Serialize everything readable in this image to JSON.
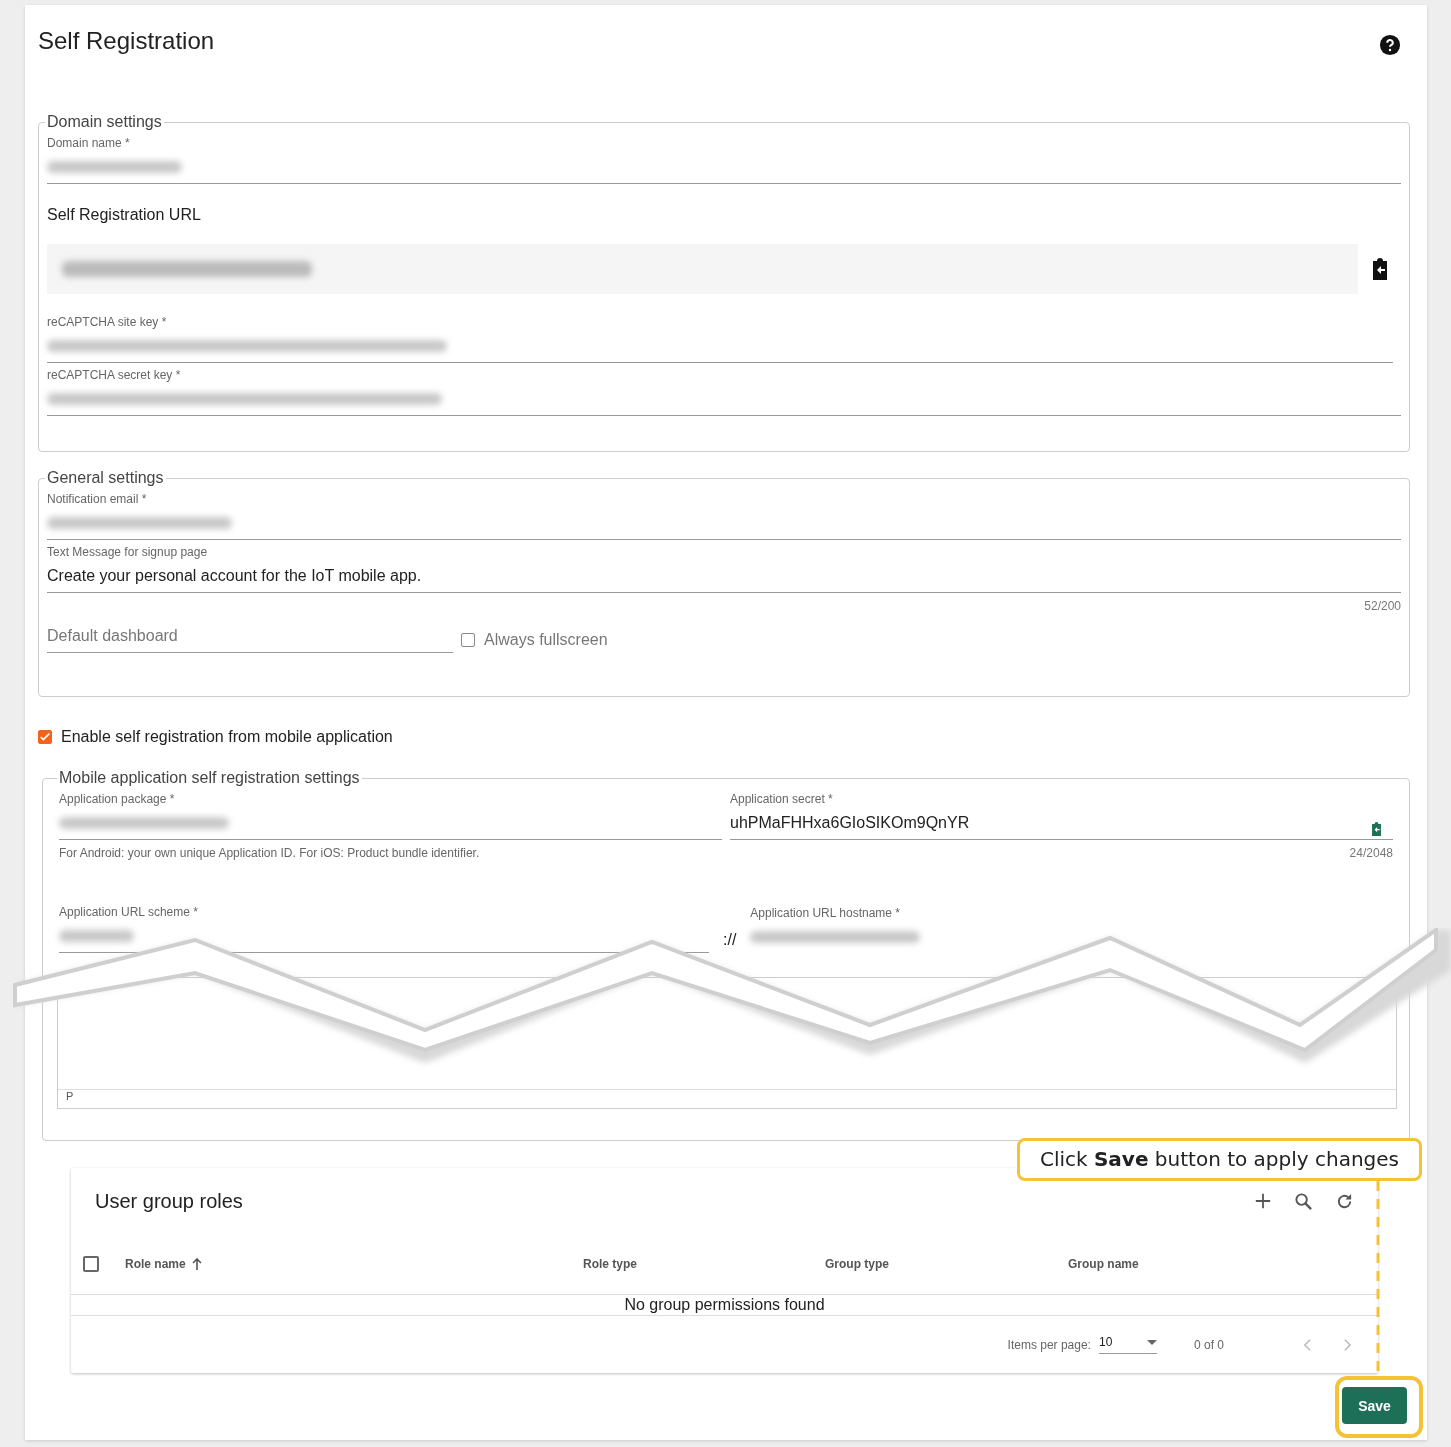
{
  "page": {
    "title": "Self Registration"
  },
  "domain_settings": {
    "legend": "Domain settings",
    "domain_name": {
      "label": "Domain name *"
    },
    "url_label": "Self Registration URL",
    "recaptcha_site_key": {
      "label": "reCAPTCHA site key *"
    },
    "recaptcha_secret_key": {
      "label": "reCAPTCHA secret key *"
    }
  },
  "general_settings": {
    "legend": "General settings",
    "notification_email": {
      "label": "Notification email *"
    },
    "signup_message": {
      "label": "Text Message for signup page",
      "value": "Create your personal account for the IoT mobile app.",
      "counter": "52/200"
    },
    "default_dashboard": {
      "placeholder": "Default dashboard"
    },
    "always_fullscreen": {
      "label": "Always fullscreen",
      "checked": false
    }
  },
  "enable_mobile": {
    "label": "Enable self registration from mobile application",
    "checked": true
  },
  "mobile_settings": {
    "legend": "Mobile application self registration settings",
    "application_package": {
      "label": "Application package *",
      "hint": "For Android: your own unique Application ID. For iOS: Product bundle identifier."
    },
    "application_secret": {
      "label": "Application secret *",
      "value": "uhPMaFHHxa6GIoSIKOm9QnYR",
      "counter": "24/2048"
    },
    "url_scheme": {
      "label": "Application URL scheme *"
    },
    "separator": "://",
    "url_hostname": {
      "label": "Application URL hostname *"
    },
    "editor_status": "P"
  },
  "user_group_roles": {
    "title": "User group roles",
    "select_all_checked": false,
    "columns": [
      {
        "label": "Role name",
        "sorted": true
      },
      {
        "label": "Role type",
        "sorted": false
      },
      {
        "label": "Group type",
        "sorted": false
      },
      {
        "label": "Group name",
        "sorted": false
      }
    ],
    "empty_message": "No group permissions found",
    "paginator": {
      "items_per_page_label": "Items per page:",
      "page_size": "10",
      "range": "0 of 0"
    }
  },
  "save_button": "Save",
  "callout": "Click **Save** button to apply changes"
}
